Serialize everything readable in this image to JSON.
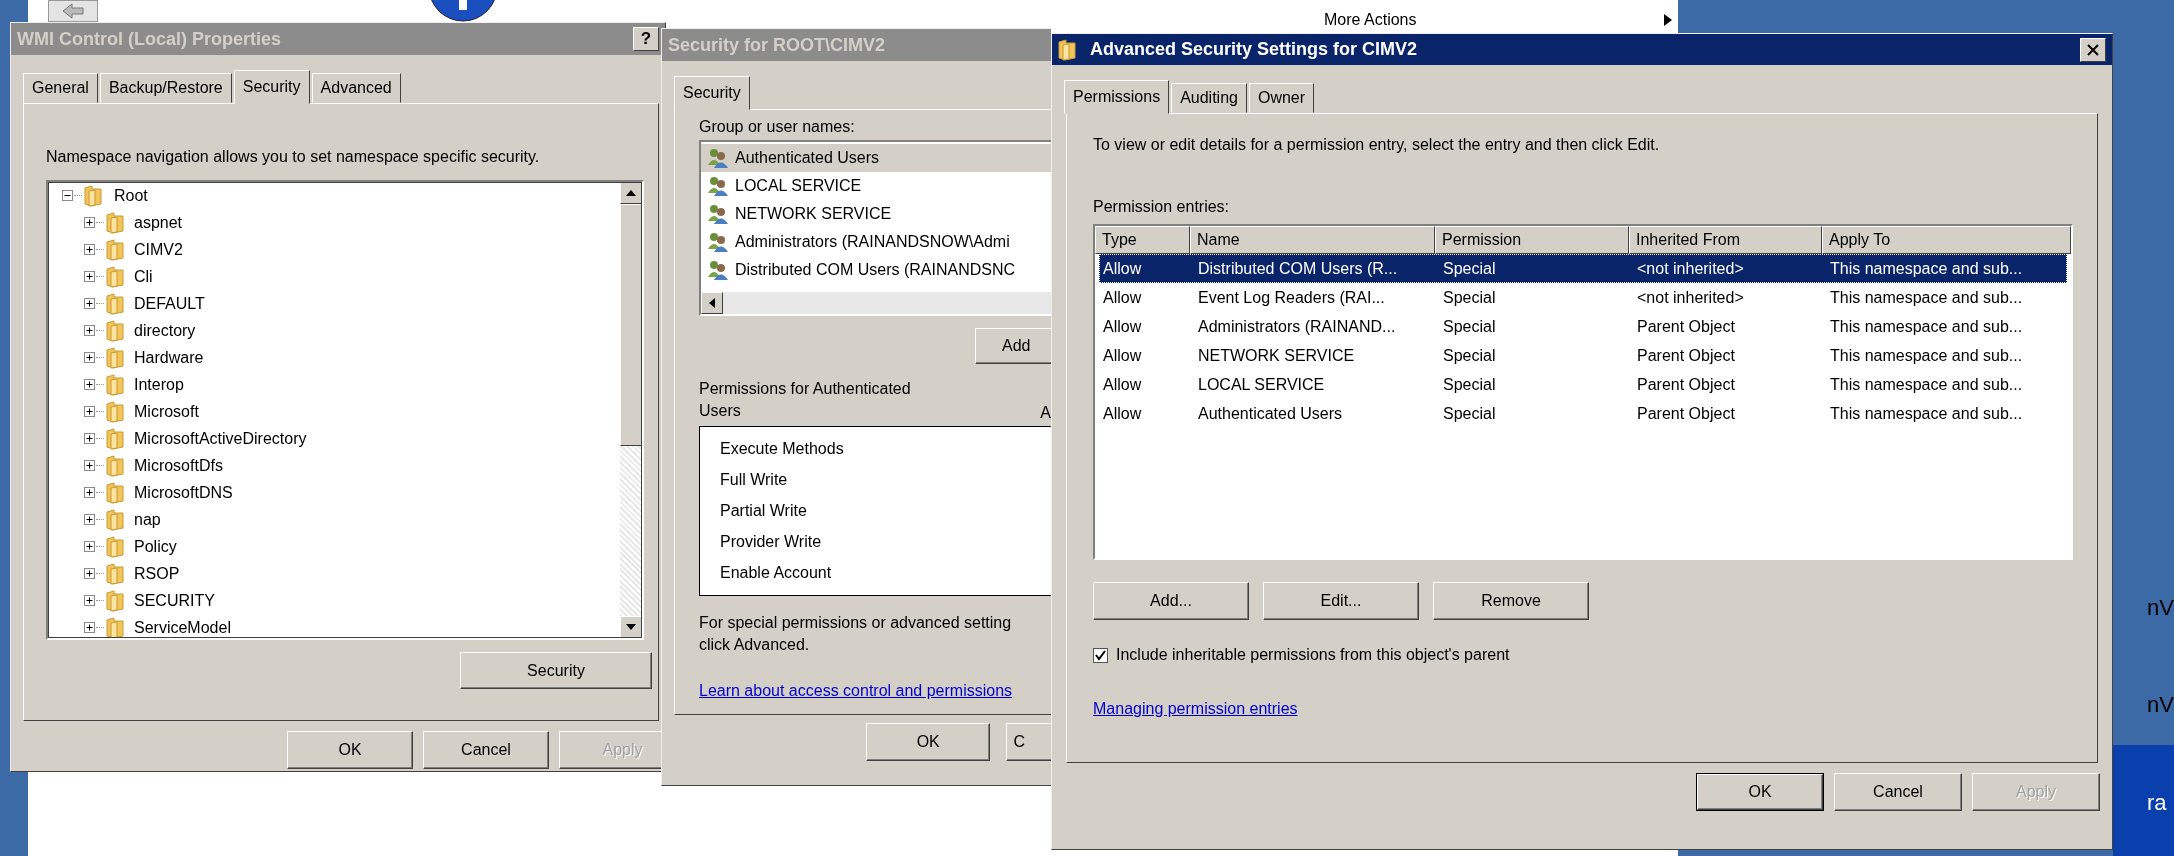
{
  "background": {
    "more_actions": "More Actions",
    "side_fragments": [
      "nV",
      "nV",
      "ra"
    ]
  },
  "wmi_properties": {
    "title": "WMI Control (Local) Properties",
    "active": false,
    "help_button": "?",
    "tabs": [
      {
        "label": "General",
        "selected": false
      },
      {
        "label": "Backup/Restore",
        "selected": false
      },
      {
        "label": "Security",
        "selected": true
      },
      {
        "label": "Advanced",
        "selected": false
      }
    ],
    "description": "Namespace navigation allows you to set namespace specific security.",
    "tree": {
      "label": "Root",
      "expanded": true,
      "children": [
        {
          "label": "aspnet",
          "expanded": false
        },
        {
          "label": "CIMV2",
          "expanded": false
        },
        {
          "label": "Cli",
          "expanded": false
        },
        {
          "label": "DEFAULT",
          "expanded": false
        },
        {
          "label": "directory",
          "expanded": false
        },
        {
          "label": "Hardware",
          "expanded": false
        },
        {
          "label": "Interop",
          "expanded": false
        },
        {
          "label": "Microsoft",
          "expanded": false
        },
        {
          "label": "MicrosoftActiveDirectory",
          "expanded": false
        },
        {
          "label": "MicrosoftDfs",
          "expanded": false
        },
        {
          "label": "MicrosoftDNS",
          "expanded": false
        },
        {
          "label": "nap",
          "expanded": false
        },
        {
          "label": "Policy",
          "expanded": false
        },
        {
          "label": "RSOP",
          "expanded": false
        },
        {
          "label": "SECURITY",
          "expanded": false
        },
        {
          "label": "ServiceModel",
          "expanded": false
        }
      ]
    },
    "security_button": "Security",
    "buttons": [
      {
        "label": "OK",
        "disabled": false
      },
      {
        "label": "Cancel",
        "disabled": false
      },
      {
        "label": "Apply",
        "disabled": true
      }
    ]
  },
  "security_dialog": {
    "title": "Security for ROOT\\CIMV2",
    "active": false,
    "tabs": [
      {
        "label": "Security",
        "selected": true
      }
    ],
    "group_label": "Group or user names:",
    "users": [
      {
        "name": "Authenticated Users",
        "selected": true
      },
      {
        "name": "LOCAL SERVICE",
        "selected": false
      },
      {
        "name": "NETWORK SERVICE",
        "selected": false
      },
      {
        "name": "Administrators (RAINANDSNOW\\Admi",
        "selected": false
      },
      {
        "name": "Distributed COM Users (RAINANDSNC",
        "selected": false
      }
    ],
    "add_button": "Add",
    "permissions_label": "Permissions for Authenticated Users",
    "column_2": "A",
    "permissions": [
      "Execute Methods",
      "Full Write",
      "Partial Write",
      "Provider Write",
      "Enable Account"
    ],
    "note_lines": [
      "For special permissions or advanced setting",
      "click Advanced."
    ],
    "link": "Learn about access control and permissions",
    "buttons": [
      {
        "label": "OK",
        "disabled": false
      },
      {
        "label": "C",
        "disabled": false
      }
    ]
  },
  "advanced_security": {
    "title": "Advanced Security Settings for CIMV2",
    "active": true,
    "tabs": [
      {
        "label": "Permissions",
        "selected": true
      },
      {
        "label": "Auditing",
        "selected": false
      },
      {
        "label": "Owner",
        "selected": false
      }
    ],
    "description": "To view or edit details for a permission entry, select the entry and then click Edit.",
    "entries_label": "Permission entries:",
    "columns": [
      "Type",
      "Name",
      "Permission",
      "Inherited From",
      "Apply To"
    ],
    "rows": [
      {
        "cells": [
          "Allow",
          "Distributed COM Users (R...",
          "Special",
          "<not inherited>",
          "This namespace and sub..."
        ],
        "selected": true
      },
      {
        "cells": [
          "Allow",
          "Event Log Readers (RAI...",
          "Special",
          "<not inherited>",
          "This namespace and sub..."
        ],
        "selected": false
      },
      {
        "cells": [
          "Allow",
          "Administrators (RAINAND...",
          "Special",
          "Parent Object",
          "This namespace and sub..."
        ],
        "selected": false
      },
      {
        "cells": [
          "Allow",
          "NETWORK SERVICE",
          "Special",
          "Parent Object",
          "This namespace and sub..."
        ],
        "selected": false
      },
      {
        "cells": [
          "Allow",
          "LOCAL SERVICE",
          "Special",
          "Parent Object",
          "This namespace and sub..."
        ],
        "selected": false
      },
      {
        "cells": [
          "Allow",
          "Authenticated Users",
          "Special",
          "Parent Object",
          "This namespace and sub..."
        ],
        "selected": false
      }
    ],
    "action_buttons": [
      "Add...",
      "Edit...",
      "Remove"
    ],
    "inherit_checkbox": {
      "label": "Include inheritable permissions from this object's parent",
      "checked": true
    },
    "link": "Managing permission entries",
    "buttons": [
      {
        "label": "OK",
        "disabled": false,
        "default": true
      },
      {
        "label": "Cancel",
        "disabled": false,
        "default": false
      },
      {
        "label": "Apply",
        "disabled": true,
        "default": false
      }
    ]
  }
}
